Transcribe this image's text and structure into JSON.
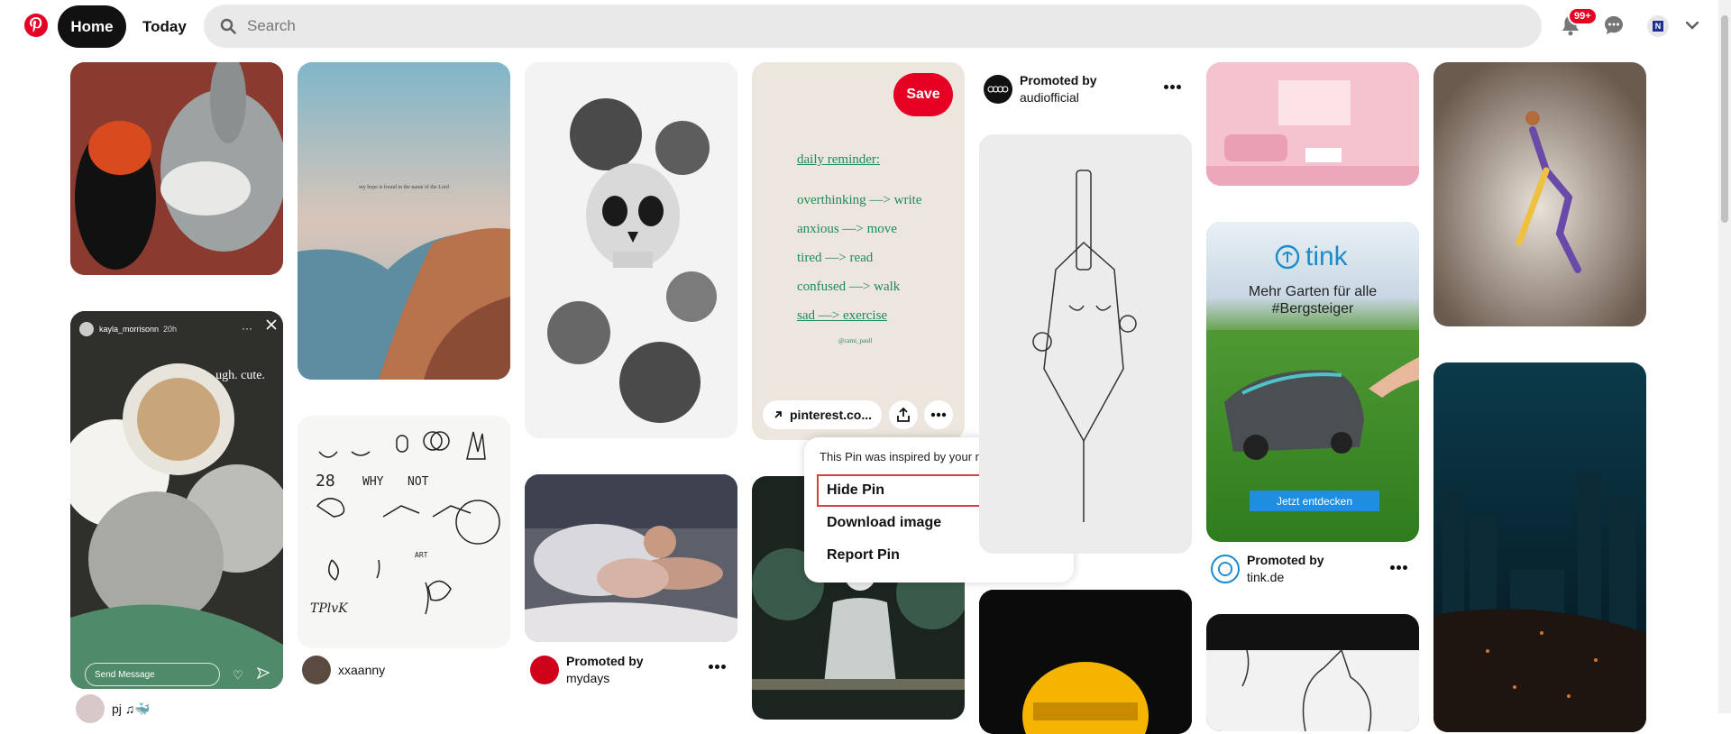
{
  "colors": {
    "brand": "#e60023",
    "text": "#111111",
    "search_bg": "#e9e9e9",
    "highlight": "#d94036"
  },
  "topbar": {
    "logo_icon": "pinterest-logo-icon",
    "home_label": "Home",
    "today_label": "Today",
    "search_placeholder": "Search",
    "notification_badge": "99+",
    "avatar_initial": "N"
  },
  "pins": {
    "col1": {
      "author": "pj ♫🐳",
      "story_user": "kayla_morrisonn",
      "story_time": "20h",
      "story_caption": "ugh. cute.",
      "story_message": "Send Message"
    },
    "col2": {
      "author": "xxaanny",
      "caption": "my hope is found in the name of the Lord",
      "doodle_numbers": "28",
      "doodle_why": "WHY",
      "doodle_not": "NOT",
      "doodle_art": "ART",
      "doodle_thx": "TPlvK"
    },
    "col3": {
      "promoted_label": "Promoted by",
      "advertiser": "mydays"
    },
    "col4": {
      "save_label": "Save",
      "link_label": "pinterest.co...",
      "note_heading": "daily reminder:",
      "note_lines": [
        "overthinking —> write",
        "anxious —> move",
        "tired —> read",
        "confused —> walk",
        "sad —> exercise"
      ],
      "note_handle": "@cami_paull"
    },
    "col5": {
      "promoted_label": "Promoted by",
      "advertiser": "audiofficial"
    },
    "col6": {
      "promoted_label": "Promoted by",
      "advertiser": "tink.de",
      "ad_logo": "tink",
      "ad_headline_1": "Mehr Garten für alle",
      "ad_headline_2": "#Bergsteiger",
      "ad_cta": "Jetzt entdecken"
    }
  },
  "menu": {
    "info": "This Pin was inspired by your recent activity",
    "items": [
      "Hide Pin",
      "Download image",
      "Report Pin"
    ]
  }
}
